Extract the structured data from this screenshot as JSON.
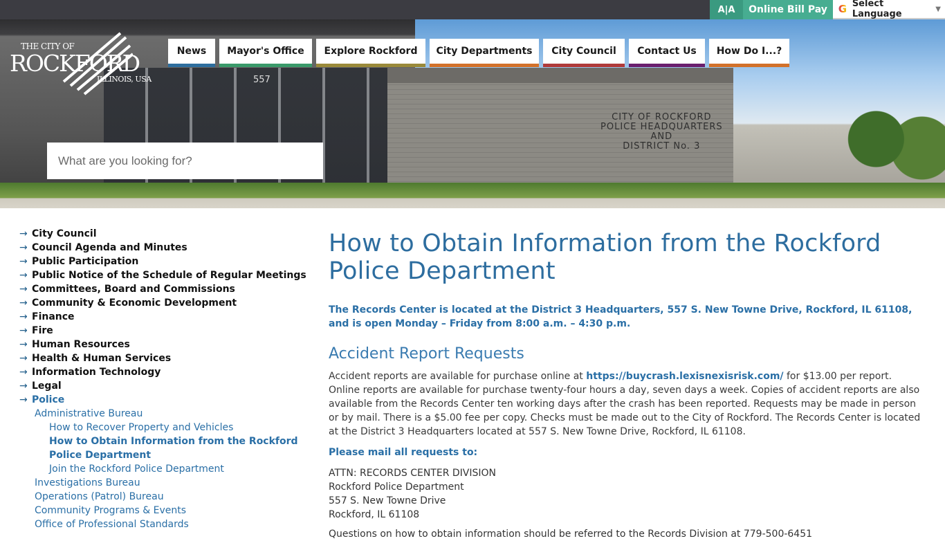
{
  "topbar": {
    "aa_label": "A|A",
    "bill_pay_label": "Online Bill Pay",
    "language_label": "Select Language"
  },
  "logo": {
    "line1": "THE CITY OF",
    "line2": "ROCKFORD",
    "line3": "ILLINOIS, USA"
  },
  "hero": {
    "building_text": [
      "CITY OF ROCKFORD",
      "POLICE HEADQUARTERS",
      "AND",
      "DISTRICT No. 3"
    ],
    "door_number": "557"
  },
  "nav": {
    "items": [
      {
        "label": "News",
        "color": "#2e6e9e",
        "width": 68
      },
      {
        "label": "Mayor's Office",
        "color": "#3a9a6a",
        "width": 134
      },
      {
        "label": "Explore Rockford",
        "color": "#9a8a3a",
        "width": 158
      },
      {
        "label": "City Departments",
        "color": "#d2712a",
        "width": 158
      },
      {
        "label": "City Council",
        "color": "#b03a3a",
        "width": 118
      },
      {
        "label": "Contact Us",
        "color": "#6a1f6e",
        "width": 110
      },
      {
        "label": "How Do I...?",
        "color": "#d2712a",
        "width": 116
      }
    ]
  },
  "search": {
    "placeholder": "What are you looking for?"
  },
  "sidebar": {
    "items": [
      "City Council",
      "Council Agenda and Minutes",
      "Public Participation",
      "Public Notice of the Schedule of Regular Meetings",
      "Committees, Board and Commissions",
      "Community & Economic Development",
      "Finance",
      "Fire",
      "Human Resources",
      "Health & Human Services",
      "Information Technology",
      "Legal",
      "Police"
    ],
    "police_sub": {
      "admin": "Administrative Bureau",
      "admin_children": [
        "How to Recover Property and Vehicles",
        "How to Obtain Information from the Rockford Police Department",
        "Join the Rockford Police Department"
      ],
      "others": [
        "Investigations Bureau",
        "Operations (Patrol) Bureau",
        "Community Programs & Events",
        "Office of Professional Standards"
      ]
    }
  },
  "content": {
    "title": "How to Obtain Information from the Rockford Police Department",
    "intro": "The Records Center is located at the District 3 Headquarters, 557 S. New Towne Drive, Rockford, IL 61108, and is open Monday – Friday from 8:00 a.m. – 4:30 p.m.",
    "section_title": "Accident Report Requests",
    "para_before_link": "Accident reports are available for purchase online at ",
    "link_text": "https://buycrash.lexisnexisrisk.com/",
    "para_after_link": " for $13.00 per report. Online reports are available for purchase twenty-four hours a day, seven days a week. Copies of accident reports are also available from the Records Center ten working days after the crash has been reported. Requests may be made in person or by mail. There is a $5.00 fee per copy. Checks must be made out to the City of Rockford.  The Records Center is located at the District 3 Headquarters located at 557 S. New Towne Drive, Rockford, IL 61108.",
    "mail_label": "Please mail all requests to:",
    "address": [
      "ATTN: RECORDS CENTER DIVISION",
      "Rockford Police Department",
      "557 S. New Towne Drive",
      "Rockford, IL 61108"
    ],
    "footnote": "Questions on how to obtain information should be referred to the Records Division at 779-500-6451"
  }
}
